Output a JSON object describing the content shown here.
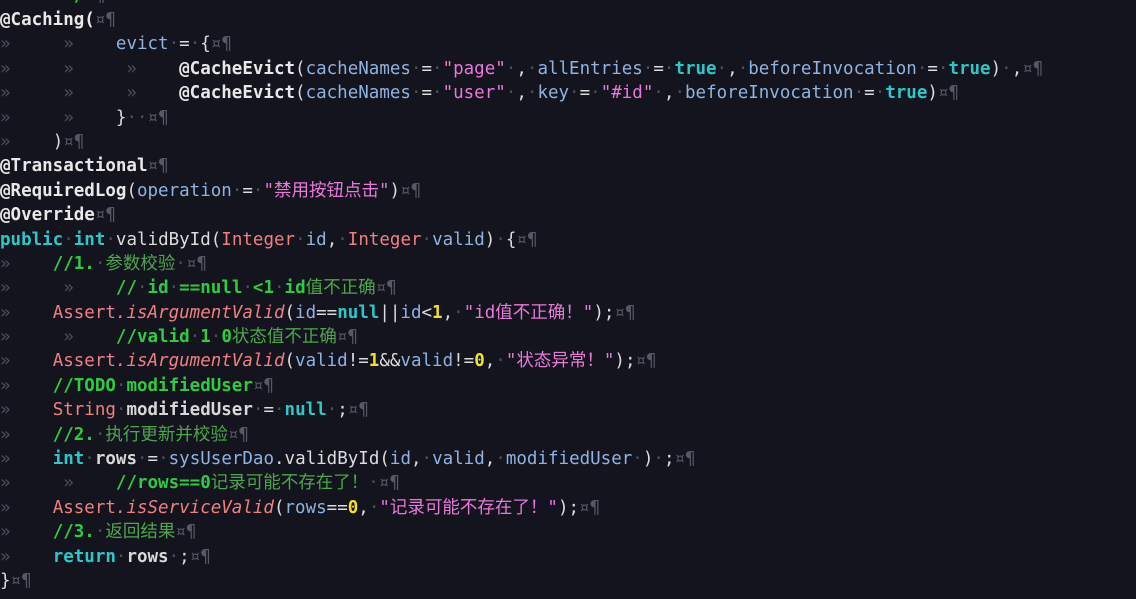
{
  "app": {
    "kind": "code-editor",
    "language": "Java",
    "theme": "darcula",
    "background": "#14141f",
    "show_whitespace": true,
    "whitespace_glyphs": {
      "tab": "»",
      "space": "·",
      "eol": "¤¶"
    }
  },
  "colors": {
    "background": "#14141f",
    "foreground": "#dcdcdc",
    "keyword": "#2bc8c8",
    "class": "#f08080",
    "method": "#f08080",
    "field": "#8fb3e0",
    "local_var": "#d8d8d8",
    "string": "#e879d8",
    "number": "#f2e12c",
    "comment": "#4ca64c",
    "comment_bold": "#2ecc40",
    "whitespace": "#4d4d5c",
    "eol_marker": "#575766"
  },
  "code": {
    "clipped_top_line": "*/¤¶",
    "lines": [
      "@Caching(¤¶",
      "»\t»\tevict·=·{¤¶",
      "»\t»\t»\t@CacheEvict(cacheNames·=·\"page\"·,·allEntries·=·true·,·beforeInvocation·=·true)·,¤¶",
      "»\t»\t»\t@CacheEvict(cacheNames·=·\"user\"·,·key·=·\"#id\"·,·beforeInvocation·=·true)¤¶",
      "»\t»\t}··¤¶",
      "»\t)¤¶",
      "@Transactional¤¶",
      "@RequiredLog(operation·=·\"禁用按钮点击\")¤¶",
      "@Override¤¶",
      "public·int·validById(Integer·id,·Integer·valid)·{¤¶",
      "»\t//1.·参数校验·¤¶",
      "»\t»\t//·id·==null·<1·id值不正确¤¶",
      "»\tAssert.isArgumentValid(id==null||id<1,·\"id值不正确！\");¤¶",
      "»\t»\t//valid·1·0状态值不正确¤¶",
      "»\tAssert.isArgumentValid(valid!=1&&valid!=0,·\"状态异常！\");¤¶",
      "»\t//TODO·modifiedUser¤¶",
      "»\tString·modifiedUser·=·null·;¤¶",
      "»\t//2.·执行更新并校验¤¶",
      "»\tint·rows·=·sysUserDao.validById(id,·valid,·modifiedUser·)·;¤¶",
      "»\t»\t//rows==0记录可能不存在了！·¤¶",
      "»\tAssert.isServiceValid(rows==0,·\"记录可能不存在了！\");¤¶",
      "»\t//3.·返回结果¤¶",
      "»\treturn·rows·;¤¶",
      "}¤¶"
    ],
    "annotations": [
      "@Caching",
      "@CacheEvict",
      "@Transactional",
      "@RequiredLog",
      "@Override"
    ],
    "method_signature": "public int validById(Integer id, Integer valid)",
    "strings": [
      "page",
      "user",
      "#id",
      "禁用按钮点击",
      "id值不正确！",
      "状态异常！",
      "记录可能不存在了！"
    ],
    "comments": [
      "//1. 参数校验",
      "// id ==null <1 id值不正确",
      "//valid 1 0状态值不正确",
      "//TODO modifiedUser",
      "//2. 执行更新并校验",
      "//rows==0记录可能不存在了！",
      "//3. 返回结果"
    ],
    "keywords": [
      "public",
      "int",
      "true",
      "null",
      "return"
    ],
    "numbers": [
      "1",
      "0"
    ],
    "identifiers": [
      "evict",
      "cacheNames",
      "allEntries",
      "beforeInvocation",
      "key",
      "operation",
      "validById",
      "Integer",
      "id",
      "valid",
      "Assert",
      "isArgumentValid",
      "isServiceValid",
      "String",
      "modifiedUser",
      "rows",
      "sysUserDao",
      "TODO"
    ]
  }
}
